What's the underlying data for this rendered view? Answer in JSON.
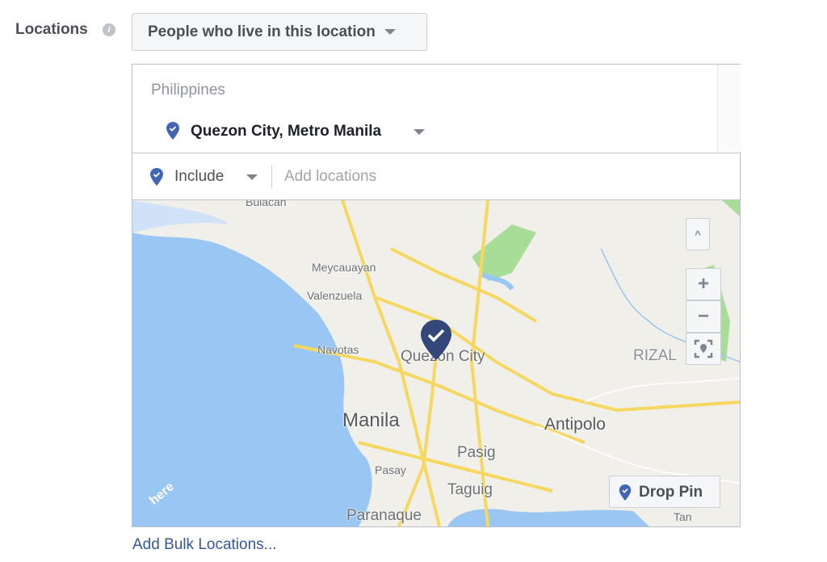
{
  "locations": {
    "label": "Locations",
    "info_icon": "info-icon",
    "type_selector": "People who live in this location"
  },
  "selected": {
    "country": "Philippines",
    "city": "Quezon City, Metro Manila"
  },
  "search": {
    "mode": "Include",
    "placeholder": "Add locations",
    "value": ""
  },
  "map": {
    "labels": {
      "bulacan": "Bulacan",
      "meycauayan": "Meycauayan",
      "valenzuela": "Valenzuela",
      "navotas": "Navotas",
      "quezon": "Quezon City",
      "manila": "Manila",
      "antipolo": "Antipolo",
      "pasig": "Pasig",
      "pasay": "Pasay",
      "taguig": "Taguig",
      "paranaque": "Paranaque",
      "rizal": "RIZAL",
      "tan": "Tan"
    },
    "provider_logo": "here",
    "controls": {
      "collapse": "^",
      "zoom_in": "+",
      "zoom_out": "−",
      "recenter": "recenter-icon"
    },
    "drop_pin": "Drop Pin"
  },
  "footer": {
    "bulk_link": "Add Bulk Locations..."
  },
  "colors": {
    "pin": "#4267b2",
    "water": "#99c6f2",
    "land": "#f0efea",
    "road": "#f6d860",
    "park": "#a8dd98",
    "link": "#365899"
  }
}
